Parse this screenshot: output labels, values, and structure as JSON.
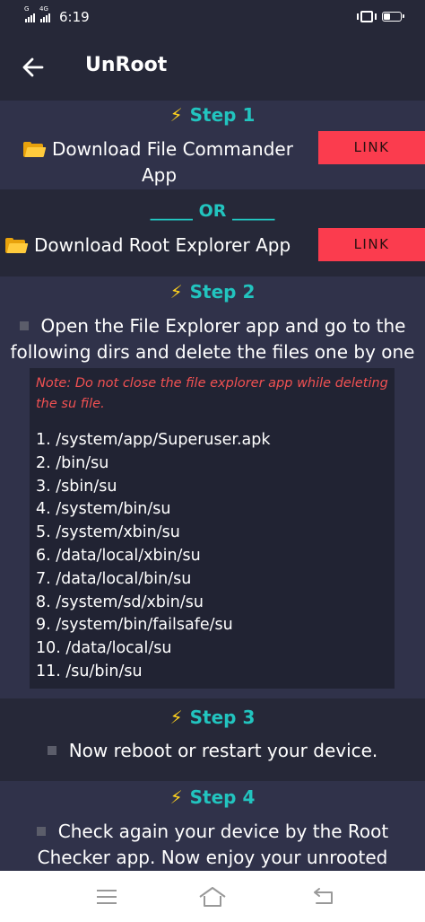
{
  "status_bar": {
    "sim1_label": "G",
    "sim2_label": "4G",
    "time": "6:19",
    "icons": [
      "signal-icon",
      "vibrate-icon",
      "battery-icon"
    ]
  },
  "app_bar": {
    "title": "UnRoot",
    "back_icon": "arrow-left-icon"
  },
  "colors": {
    "background": "#262838",
    "band_alt": "#30324a",
    "accent_teal": "#22c4bf",
    "bolt_yellow": "#ffd21e",
    "link_red": "#fb3c4e",
    "note_red": "#f15152"
  },
  "steps": [
    {
      "title": "Step 1",
      "icon": "lightning-bolt-icon",
      "downloads": [
        {
          "line1": "Download File Commander",
          "line2": "App",
          "icon": "folder-icon",
          "link_label": "LINK"
        }
      ]
    },
    {
      "or_label": "_____ OR _____",
      "downloads": [
        {
          "line1": "Download Root Explorer App",
          "icon": "folder-icon",
          "link_label": "LINK"
        }
      ]
    },
    {
      "title": "Step 2",
      "icon": "lightning-bolt-icon",
      "line1": "Open the File Explorer app and go to the",
      "line2": "following dirs and delete the files one by one",
      "note_line1": "Note: Do not close the file explorer app while deleting",
      "note_line2": "the su file.",
      "paths": [
        "1.  /system/app/Superuser.apk",
        "2.  /bin/su",
        "3.  /sbin/su",
        "4.  /system/bin/su",
        "5.  /system/xbin/su",
        "6.  /data/local/xbin/su",
        "7.  /data/local/bin/su",
        "8.  /system/sd/xbin/su",
        "9.  /system/bin/failsafe/su",
        "10.  /data/local/su",
        "11.  /su/bin/su"
      ]
    },
    {
      "title": "Step 3",
      "icon": "lightning-bolt-icon",
      "line1": "Now reboot or restart your device."
    },
    {
      "title": "Step 4",
      "icon": "lightning-bolt-icon",
      "line1": "Check again your device by the Root",
      "line2": "Checker app. Now enjoy your unrooted"
    }
  ],
  "nav_bar": {
    "icons": [
      "menu-icon",
      "home-icon",
      "back-icon"
    ]
  }
}
